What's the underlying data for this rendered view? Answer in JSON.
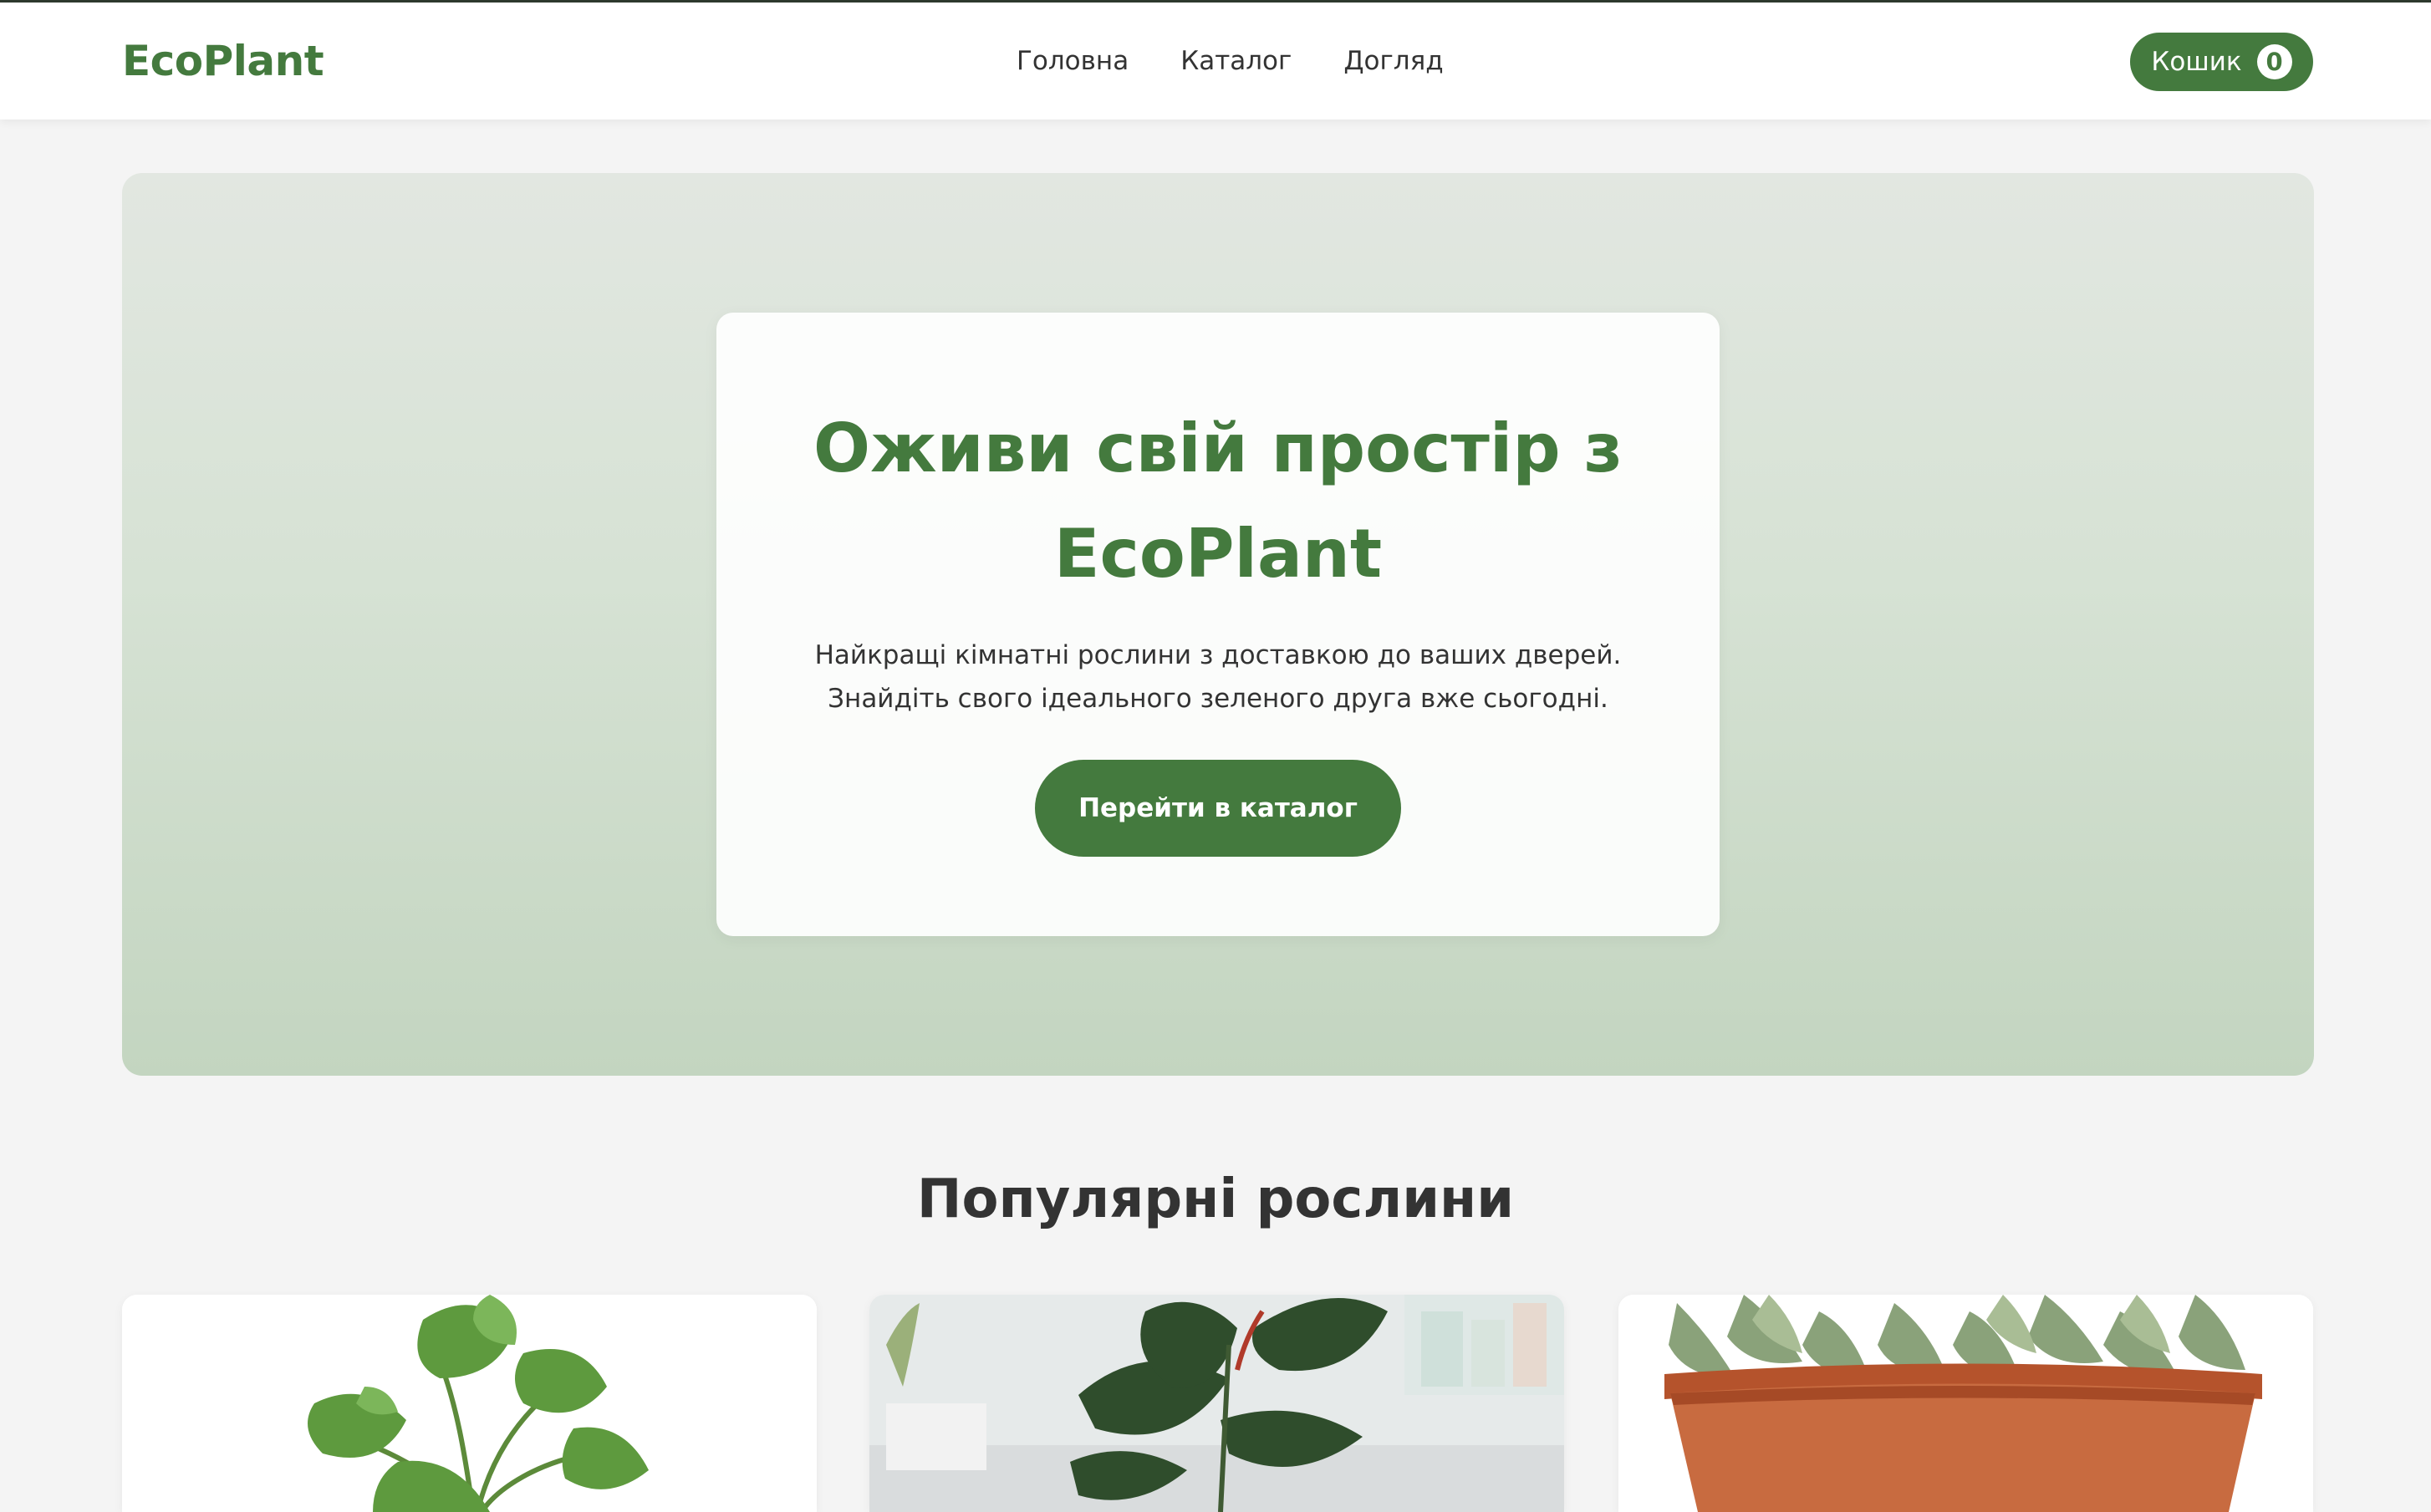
{
  "header": {
    "logo": "EcoPlant",
    "nav": [
      "Головна",
      "Каталог",
      "Догляд"
    ],
    "cart_label": "Кошик",
    "cart_count": "0"
  },
  "hero": {
    "title": "Оживи свій простір з EcoPlant",
    "text": "Найкращі кімнатні рослини з доставкою до ваших дверей. Знайдіть свого ідеального зеленого друга вже сьогодні.",
    "button": "Перейти в каталог"
  },
  "popular": {
    "title": "Популярні рослини"
  },
  "colors": {
    "brand": "#447a3e",
    "background": "#f4f4f4"
  }
}
